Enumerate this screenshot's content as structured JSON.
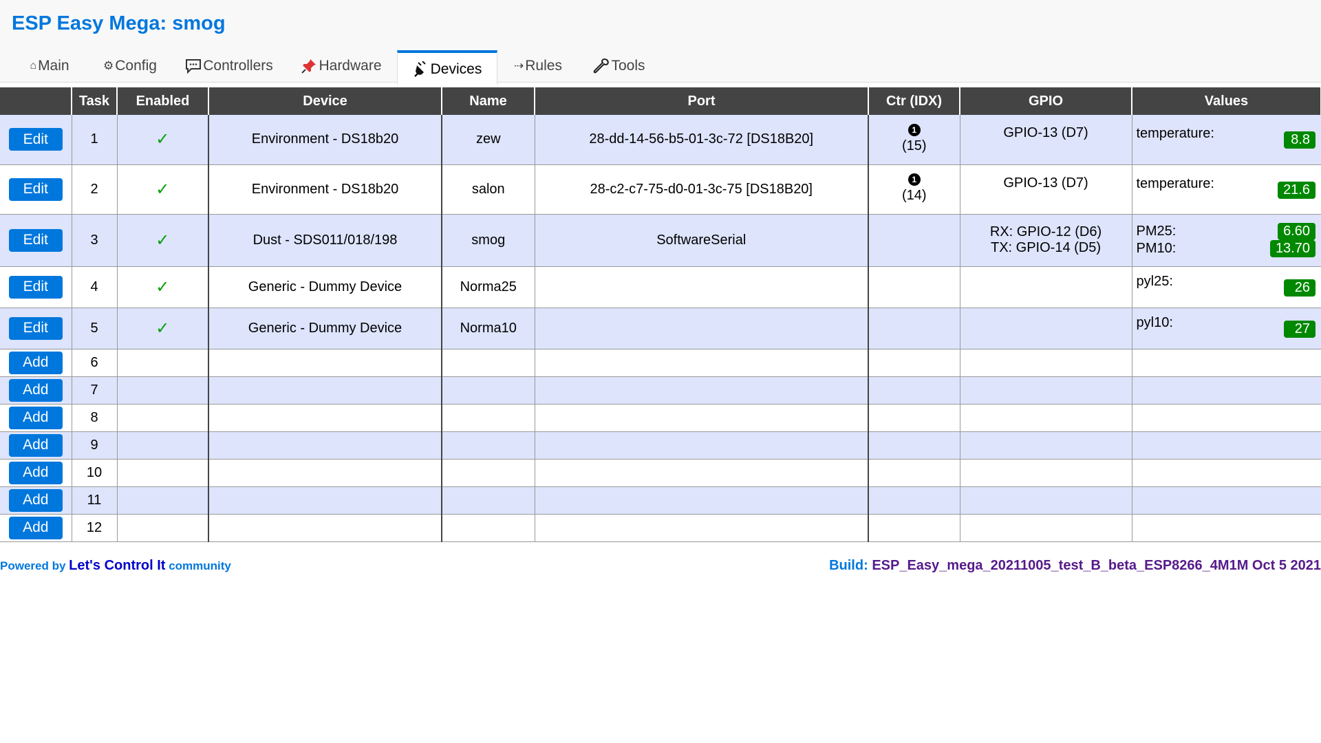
{
  "app": {
    "title": "ESP Easy Mega: smog"
  },
  "tabs": [
    {
      "icon": "home-icon",
      "glyph": "⌂",
      "label": "Main"
    },
    {
      "icon": "gear-icon",
      "glyph": "⚙",
      "label": "Config"
    },
    {
      "icon": "chat-icon",
      "glyph": "",
      "label": "Controllers"
    },
    {
      "icon": "pushpin-icon",
      "glyph": "",
      "label": "Hardware"
    },
    {
      "icon": "plug-icon",
      "glyph": "",
      "label": "Devices"
    },
    {
      "icon": "arrow-icon",
      "glyph": "⇢",
      "label": "Rules"
    },
    {
      "icon": "wrench-icon",
      "glyph": "",
      "label": "Tools"
    }
  ],
  "table": {
    "headers": [
      "",
      "Task",
      "Enabled",
      "Device",
      "Name",
      "Port",
      "Ctr (IDX)",
      "GPIO",
      "Values"
    ],
    "rows": [
      {
        "button": "Edit",
        "task": "1",
        "enabled": "✓",
        "device": "Environment - DS18b20",
        "name": "zew",
        "port": "28-dd-14-56-b5-01-3c-72 [DS18B20]",
        "ctr": "1",
        "idx": "(15)",
        "gpio": [
          "GPIO-13 (D7)"
        ],
        "values": [
          {
            "label": "temperature:",
            "value": "8.8"
          }
        ]
      },
      {
        "button": "Edit",
        "task": "2",
        "enabled": "✓",
        "device": "Environment - DS18b20",
        "name": "salon",
        "port": "28-c2-c7-75-d0-01-3c-75 [DS18B20]",
        "ctr": "1",
        "idx": "(14)",
        "gpio": [
          "GPIO-13 (D7)"
        ],
        "values": [
          {
            "label": "temperature:",
            "value": "21.6"
          }
        ]
      },
      {
        "button": "Edit",
        "task": "3",
        "enabled": "✓",
        "device": "Dust - SDS011/018/198",
        "name": "smog",
        "port": "SoftwareSerial",
        "ctr": "",
        "idx": "",
        "gpio": [
          "RX: GPIO-12 (D6)",
          "TX: GPIO-14 (D5)"
        ],
        "values": [
          {
            "label": "PM25:",
            "value": "6.60"
          },
          {
            "label": "PM10:",
            "value": "13.70"
          }
        ]
      },
      {
        "button": "Edit",
        "task": "4",
        "enabled": "✓",
        "device": "Generic - Dummy Device",
        "name": "Norma25",
        "port": "",
        "ctr": "",
        "idx": "",
        "gpio": [],
        "values": [
          {
            "label": "pyl25:",
            "value": "26"
          }
        ]
      },
      {
        "button": "Edit",
        "task": "5",
        "enabled": "✓",
        "device": "Generic - Dummy Device",
        "name": "Norma10",
        "port": "",
        "ctr": "",
        "idx": "",
        "gpio": [],
        "values": [
          {
            "label": "pyl10:",
            "value": "27"
          }
        ]
      },
      {
        "button": "Add",
        "task": "6"
      },
      {
        "button": "Add",
        "task": "7"
      },
      {
        "button": "Add",
        "task": "8"
      },
      {
        "button": "Add",
        "task": "9"
      },
      {
        "button": "Add",
        "task": "10"
      },
      {
        "button": "Add",
        "task": "11"
      },
      {
        "button": "Add",
        "task": "12"
      }
    ]
  },
  "footer": {
    "powered_prefix": "Powered by",
    "powered_link": "Let's Control It",
    "powered_suffix": "community",
    "build_label": "Build:",
    "build_value": "ESP_Easy_mega_20211005_test_B_beta_ESP8266_4M1M Oct 5 2021"
  },
  "colors": {
    "accent": "#0077dd",
    "header_bg": "#444444",
    "row_alt": "#dde4fc",
    "badge_green": "#008800",
    "build_purple": "#551a8b"
  }
}
